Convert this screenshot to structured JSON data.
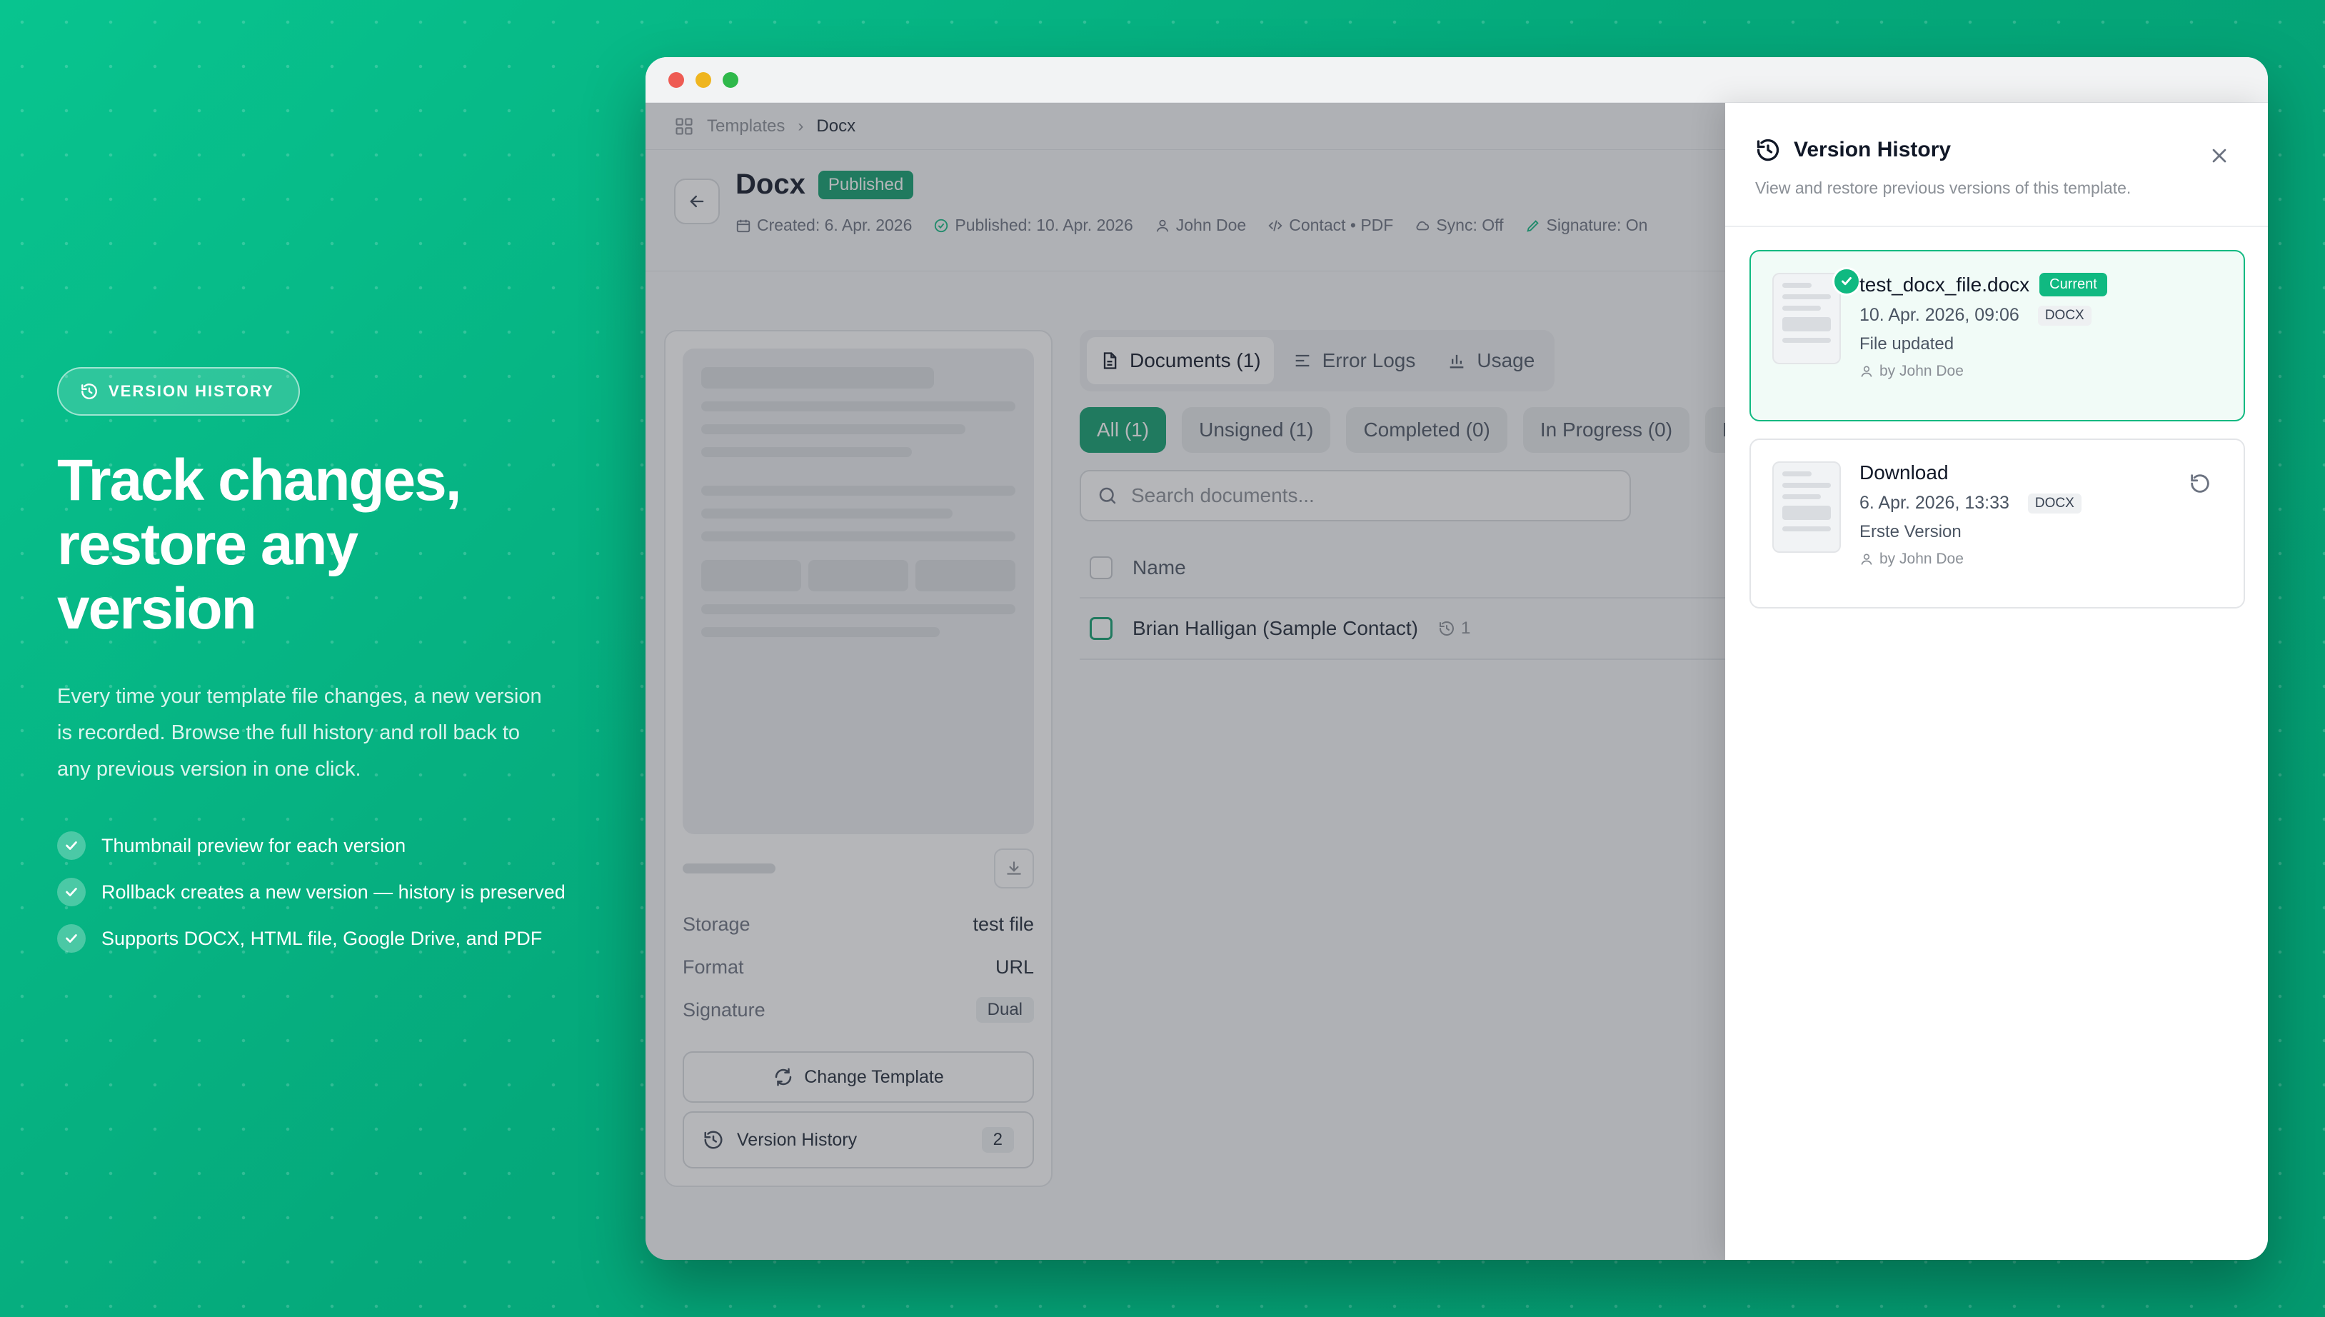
{
  "colors": {
    "brand": "#0f9f6e",
    "accent": "#10b981"
  },
  "hero": {
    "pill_label": "VERSION HISTORY",
    "title_lines": [
      "Track changes,",
      "restore any",
      "version"
    ],
    "description": "Every time your template file changes, a new version is recorded. Browse the full history and roll back to any previous version in one click.",
    "features": [
      "Thumbnail preview for each version",
      "Rollback creates a new version — history is preserved",
      "Supports DOCX, HTML file, Google Drive, and PDF"
    ]
  },
  "breadcrumb": {
    "root": "Templates",
    "current": "Docx"
  },
  "document": {
    "title": "Docx",
    "status": "Published",
    "meta": {
      "created": "Created: 6. Apr. 2026",
      "published": "Published: 10. Apr. 2026",
      "author": "John Doe",
      "mapping": "Contact • PDF",
      "sync": "Sync: Off",
      "signature": "Signature: On"
    }
  },
  "sidebar": {
    "storage_label": "Storage",
    "storage_value": "test file",
    "format_label": "Format",
    "format_value": "URL",
    "signature_label": "Signature",
    "signature_value": "Dual",
    "change_template_label": "Change Template",
    "version_history_label": "Version History",
    "version_count": "2"
  },
  "tabs": [
    {
      "label": "Documents (1)",
      "icon": "file-icon"
    },
    {
      "label": "Error Logs",
      "icon": "list-icon"
    },
    {
      "label": "Usage",
      "icon": "bar-chart-icon"
    }
  ],
  "filters": [
    "All (1)",
    "Unsigned (1)",
    "Completed (0)",
    "In Progress (0)",
    "Pe"
  ],
  "search": {
    "placeholder": "Search documents..."
  },
  "table": {
    "header_name": "Name",
    "rows": [
      {
        "name": "Brian Halligan (Sample Contact)",
        "versions": "1"
      }
    ]
  },
  "panel": {
    "title": "Version History",
    "subtitle": "View and restore previous versions of this template.",
    "versions": [
      {
        "name": "test_docx_file.docx",
        "badge": "Current",
        "date": "10. Apr. 2026, 09:06",
        "type": "DOCX",
        "note": "File updated",
        "by": "by John Doe"
      },
      {
        "name": "Download",
        "date": "6. Apr. 2026, 13:33",
        "type": "DOCX",
        "note": "Erste Version",
        "by": "by John Doe"
      }
    ]
  }
}
